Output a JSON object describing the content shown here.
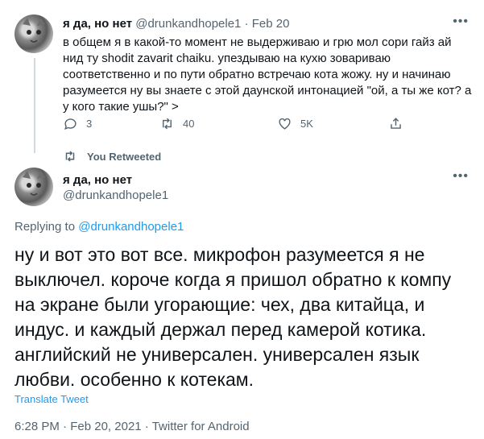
{
  "tweet1": {
    "name": "я да, но нет",
    "handle": "@drunkandhopele1",
    "separator": "·",
    "date": "Feb 20",
    "more": "•••",
    "text": "в общем я в какой-то момент не выдерживаю и грю мол сори гайз ай нид ту shodit zavarit chaiku. упездываю на кухю зовариваю соответственно и по пути обратно встречаю кота жожу. ну и начинаю разумеется ну вы знаете с этой даунской интонацией \"ой, а ты же кот? а у кого такие ушы?\" >",
    "replies": "3",
    "retweets": "40",
    "likes": "5K"
  },
  "retweet_notice": "You Retweeted",
  "tweet2": {
    "name": "я да, но нет",
    "handle": "@drunkandhopele1",
    "more": "•••",
    "replying_prefix": "Replying to",
    "replying_handle": "@drunkandhopele1",
    "text": "ну и вот это вот все. микрофон разумеется я не выключел. короче когда я пришол обратно к компу на экране были угорающие: чех, два китайца, и индус. и каждый держал перед камерой котика. английский не универсален. универсален язык любви. особенно к котекам.",
    "translate": "Translate Tweet",
    "time": "6:28 PM",
    "date": "Feb 20, 2021",
    "source": "Twitter for Android",
    "meta_separator": "·"
  },
  "colors": {
    "accent": "#1d9bf0",
    "muted": "#536471",
    "text": "#0f1419",
    "line": "#cfd9de"
  },
  "icons": [
    "reply-icon",
    "retweet-icon",
    "like-icon",
    "share-icon",
    "retweeted-icon",
    "more-icon"
  ]
}
